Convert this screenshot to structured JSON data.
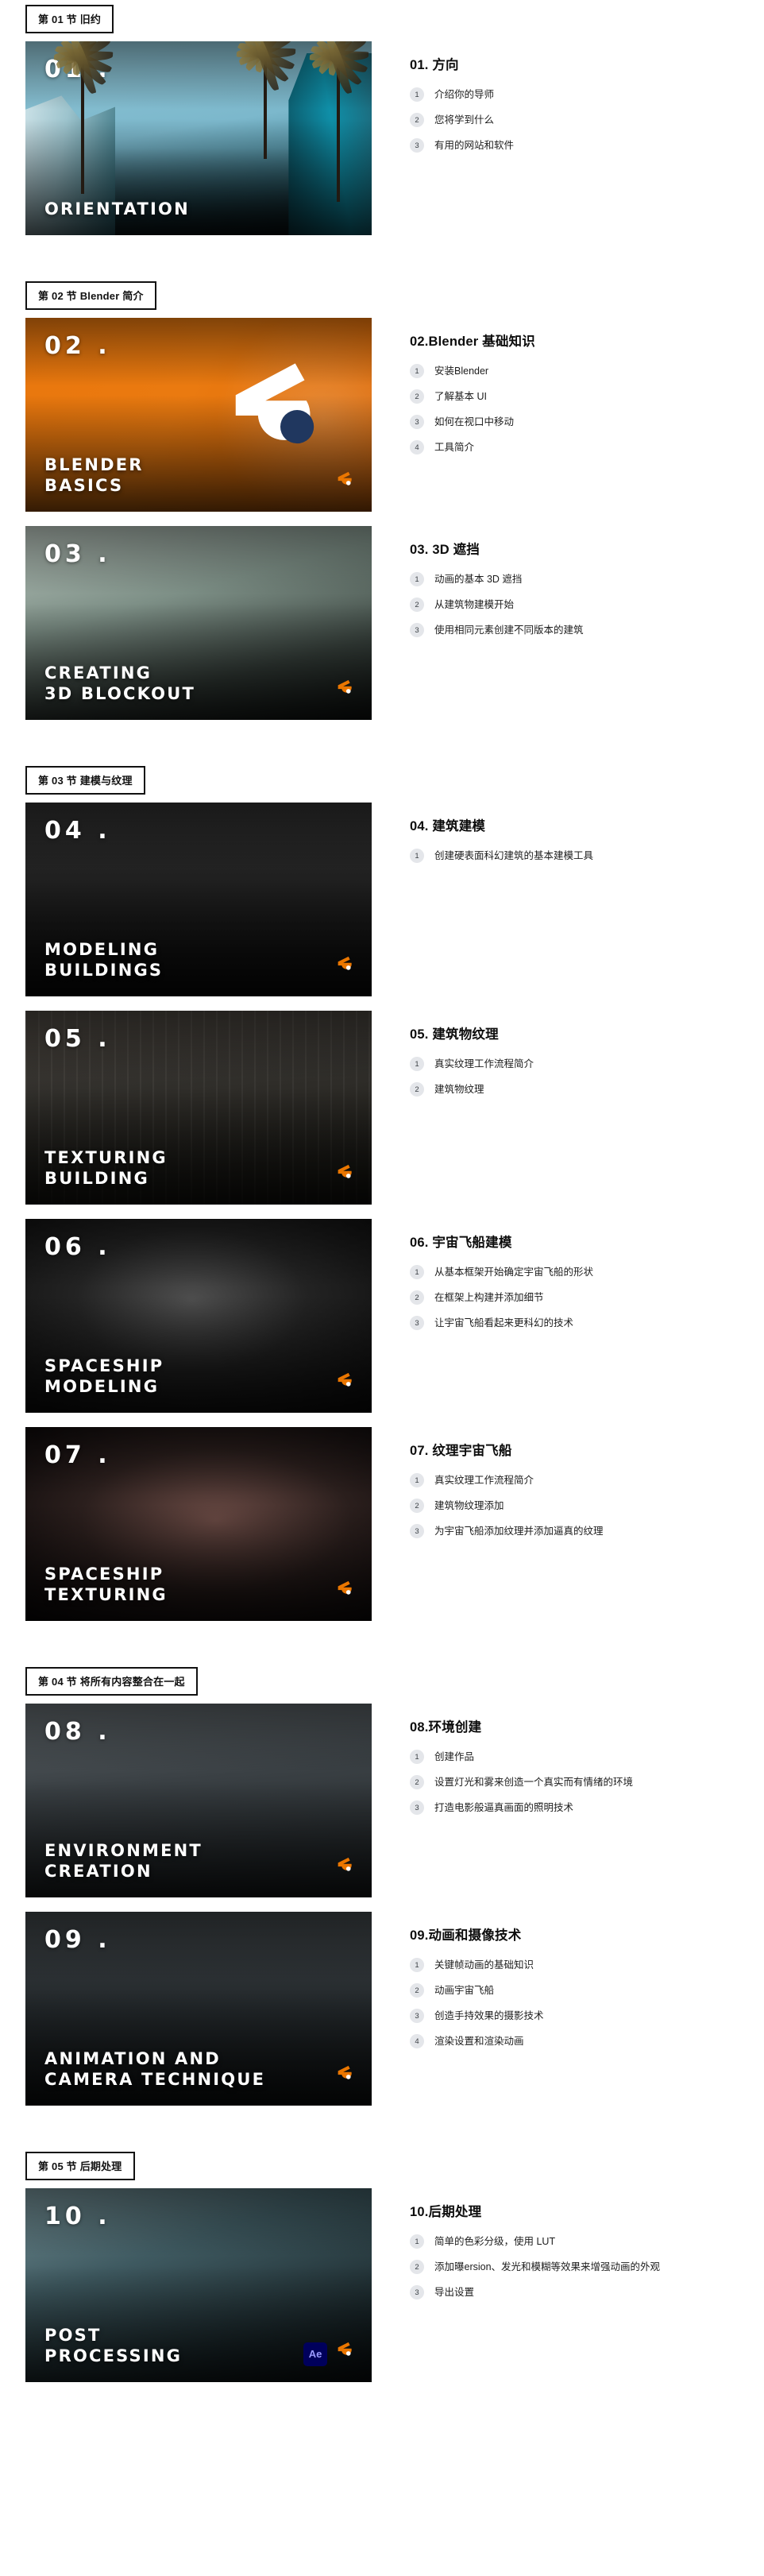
{
  "brand": {
    "accent_orange": "#ea7600",
    "blender_logo_name": "blender-logo-icon",
    "after_effects_label": "Ae"
  },
  "sections": [
    {
      "chip": "第 01 节 旧约",
      "lessons": [
        {
          "card_number": "01 .",
          "card_title": "ORIENTATION",
          "art": "art-city",
          "show_blender_logo": false,
          "show_ae_badge": false,
          "heading": "01. 方向",
          "topics": [
            "介绍你的导师",
            "您将学到什么",
            "有用的网站和软件"
          ]
        }
      ]
    },
    {
      "chip": "第 02 节 Blender 简介",
      "lessons": [
        {
          "card_number": "02 .",
          "card_title": "BLENDER\nBASICS",
          "art": "art-blender",
          "show_blender_logo": true,
          "show_ae_badge": false,
          "heading": "02.Blender 基础知识",
          "topics": [
            "安装Blender",
            "了解基本 UI",
            "如何在视口中移动",
            "工具简介"
          ]
        },
        {
          "card_number": "03 .",
          "card_title": "CREATING\n3D BLOCKOUT",
          "art": "art-blockout",
          "show_blender_logo": true,
          "show_ae_badge": false,
          "heading": "03. 3D 遮挡",
          "topics": [
            "动画的基本 3D 遮挡",
            "从建筑物建模开始",
            "使用相同元素创建不同版本的建筑"
          ]
        }
      ]
    },
    {
      "chip": "第 03 节 建模与纹理",
      "lessons": [
        {
          "card_number": "04 .",
          "card_title": "MODELING\nBUILDINGS",
          "art": "art-modeling",
          "show_blender_logo": true,
          "show_ae_badge": false,
          "heading": "04. 建筑建模",
          "topics": [
            "创建硬表面科幻建筑的基本建模工具"
          ]
        },
        {
          "card_number": "05 .",
          "card_title": "TEXTURING\nBUILDING",
          "art": "art-texturing-b",
          "show_blender_logo": true,
          "show_ae_badge": false,
          "heading": "05. 建筑物纹理",
          "topics": [
            "真实纹理工作流程简介",
            "建筑物纹理"
          ]
        },
        {
          "card_number": "06 .",
          "card_title": "SPACESHIP\nMODELING",
          "art": "art-ship",
          "show_blender_logo": true,
          "show_ae_badge": false,
          "heading": "06. 宇宙飞船建模",
          "topics": [
            "从基本框架开始确定宇宙飞船的形状",
            "在框架上构建并添加细节",
            "让宇宙飞船看起来更科幻的技术"
          ]
        },
        {
          "card_number": "07 .",
          "card_title": "SPACESHIP\nTEXTURING",
          "art": "art-shiptex",
          "show_blender_logo": true,
          "show_ae_badge": false,
          "heading": "07. 纹理宇宙飞船",
          "topics": [
            "真实纹理工作流程简介",
            "建筑物纹理添加",
            "为宇宙飞船添加纹理并添加逼真的纹理"
          ]
        }
      ]
    },
    {
      "chip": "第 04 节 将所有内容整合在一起",
      "lessons": [
        {
          "card_number": "08 .",
          "card_title": "ENVIRONMENT\nCREATION",
          "art": "art-env",
          "show_blender_logo": true,
          "show_ae_badge": false,
          "heading": "08.环境创建",
          "topics": [
            "创建作品",
            "设置灯光和雾来创造一个真实而有情绪的环境",
            "打造电影般逼真画面的照明技术"
          ]
        },
        {
          "card_number": "09 .",
          "card_title": "ANIMATION AND\nCAMERA TECHNIQUE",
          "art": "art-anim",
          "show_blender_logo": true,
          "show_ae_badge": false,
          "heading": "09.动画和摄像技术",
          "topics": [
            "关键帧动画的基础知识",
            "动画宇宙飞船",
            "创造手持效果的摄影技术",
            "渲染设置和渲染动画"
          ]
        }
      ]
    },
    {
      "chip": "第 05 节 后期处理",
      "lessons": [
        {
          "card_number": "10 .",
          "card_title": "POST\nPROCESSING",
          "art": "art-post",
          "show_blender_logo": true,
          "show_ae_badge": true,
          "heading": "10.后期处理",
          "topics": [
            "简单的色彩分级，使用 LUT",
            "添加曝ersion、发光和模糊等效果来增强动画的外观",
            "导出设置"
          ]
        }
      ]
    }
  ]
}
